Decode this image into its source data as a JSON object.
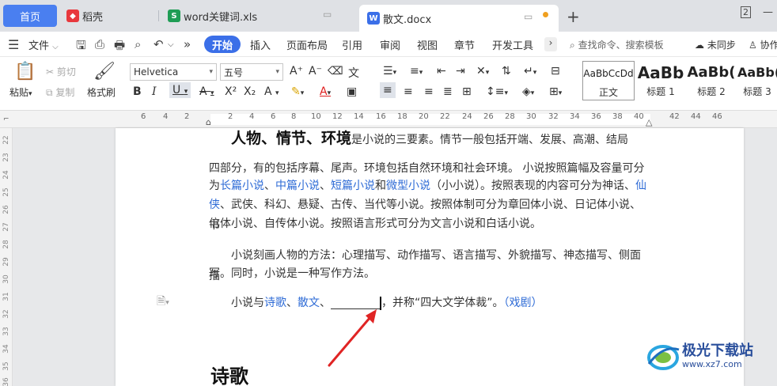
{
  "tabs": {
    "home": "首页",
    "daoke": "稻壳",
    "xls": "word关键词.xls",
    "docx": "散文.docx",
    "plus": "+",
    "layout_indicator": "2"
  },
  "menu": {
    "file": "文件",
    "items": [
      "开始",
      "插入",
      "页面布局",
      "引用",
      "审阅",
      "视图",
      "章节",
      "开发工具"
    ],
    "search": "查找命令、搜索模板",
    "sync": "未同步",
    "collab": "协作"
  },
  "ribbon": {
    "paste": "粘贴",
    "cut": "剪切",
    "copy": "复制",
    "format_painter": "格式刷",
    "font_name": "Helvetica",
    "font_size": "五号",
    "styles": [
      {
        "sample": "AaBbCcDd",
        "name": "正文"
      },
      {
        "sample": "AaBb",
        "name": "标题 1"
      },
      {
        "sample": "AaBb(",
        "name": "标题 2"
      },
      {
        "sample": "AaBb(",
        "name": "标题 3"
      }
    ]
  },
  "ruler": {
    "numbers": [
      "6",
      "4",
      "2",
      "2",
      "4",
      "6",
      "8",
      "10",
      "12",
      "14",
      "16",
      "18",
      "20",
      "22",
      "24",
      "26",
      "28",
      "30",
      "32",
      "34",
      "36",
      "38",
      "40",
      "42",
      "44",
      "46"
    ],
    "vertical": [
      "22",
      "23",
      "24",
      "25",
      "26",
      "27",
      "28",
      "29",
      "30",
      "31",
      "32",
      "33",
      "34",
      "35",
      "36"
    ]
  },
  "document": {
    "p1_head": "人物、情节、环境",
    "p1_a": "是小说的三要素。情节一般包括开端、发展、高潮、结局",
    "p1_b": "四部分，有的包括序幕、尾声。环境包括自然环境和社会环境。 小说按照篇幅及容量可分",
    "p1_c1": "为",
    "p1_link1": "长篇小说",
    "p1_c2": "、",
    "p1_link2": "中篇小说",
    "p1_c3": "、",
    "p1_link3": "短篇小说",
    "p1_c4": "和",
    "p1_link4": "微型小说",
    "p1_c5": "（小小说）。按照表现的内容可分为神话、",
    "p1_link5": "仙",
    "p1_d1": "侠",
    "p1_d2": "、武侠、科幻、悬疑、古传、当代等小说。按照体制可分为章回体小说、日记体小说、书",
    "p1_e": "信体小说、自传体小说。按照语言形式可分为文言小说和白话小说。",
    "p2_a": "小说刻画人物的方法：心理描写、动作描写、语言描写、外貌描写、神态描写、侧面描",
    "p2_b": "写。同时，小说是一种写作方法。",
    "p3_a": "小说与",
    "p3_link1": "诗歌",
    "p3_b": "、",
    "p3_link2": "散文",
    "p3_c": "、",
    "p3_d": "，并称“四大文学体裁”。",
    "p3_link3": "（戏剧）",
    "heading": "诗歌"
  },
  "watermark": {
    "name": "极光下载站",
    "url": "www.xz7.com"
  }
}
